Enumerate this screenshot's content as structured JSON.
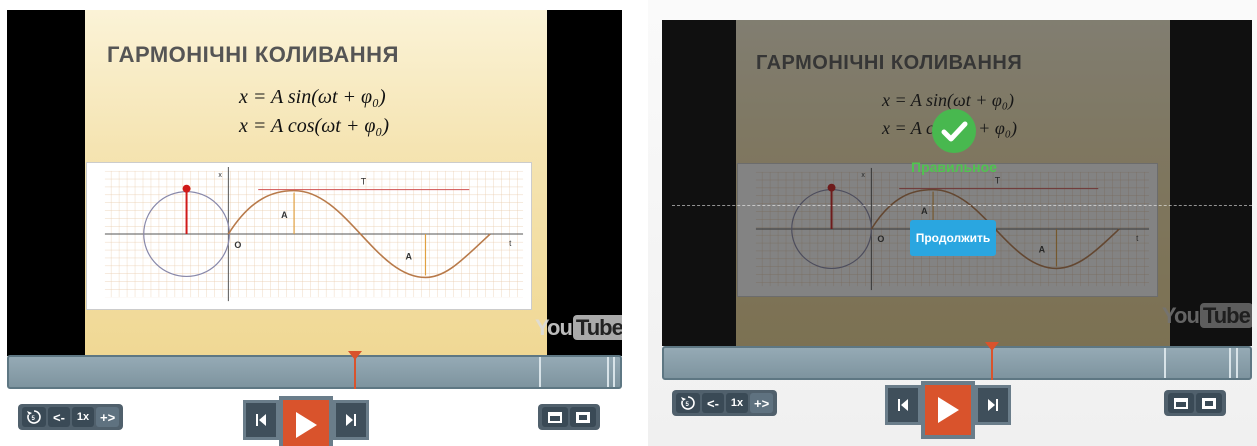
{
  "slide": {
    "title": "ГАРМОНІЧНІ КОЛИВАННЯ",
    "formula_sin": "x = A sin(ωt + φ₀)",
    "formula_cos": "x = A cos(ωt + φ₀)",
    "graph_labels": {
      "x": "x",
      "t": "t",
      "T": "T",
      "A1": "A",
      "A2": "A",
      "O": "O"
    }
  },
  "watermark": {
    "you": "You",
    "tube": "Tube"
  },
  "feedback": {
    "status": "Правильное",
    "continue_label": "Продолжить"
  },
  "controls": {
    "replay_icon": "replay-5-icon",
    "slower_label": "<-",
    "speed_label": "1x",
    "faster_label": "+>",
    "prev_icon": "skip-previous-icon",
    "play_icon": "play-icon",
    "next_icon": "skip-next-icon",
    "window_icon": "window-mode-icon",
    "fullscreen_icon": "fullscreen-icon"
  },
  "progress": {
    "left_fraction": 0.56,
    "right_fraction": 0.56
  },
  "colors": {
    "accent": "#d9532c",
    "success": "#48b84f",
    "continue": "#2aa6e0",
    "control_bg": "#50606c"
  }
}
